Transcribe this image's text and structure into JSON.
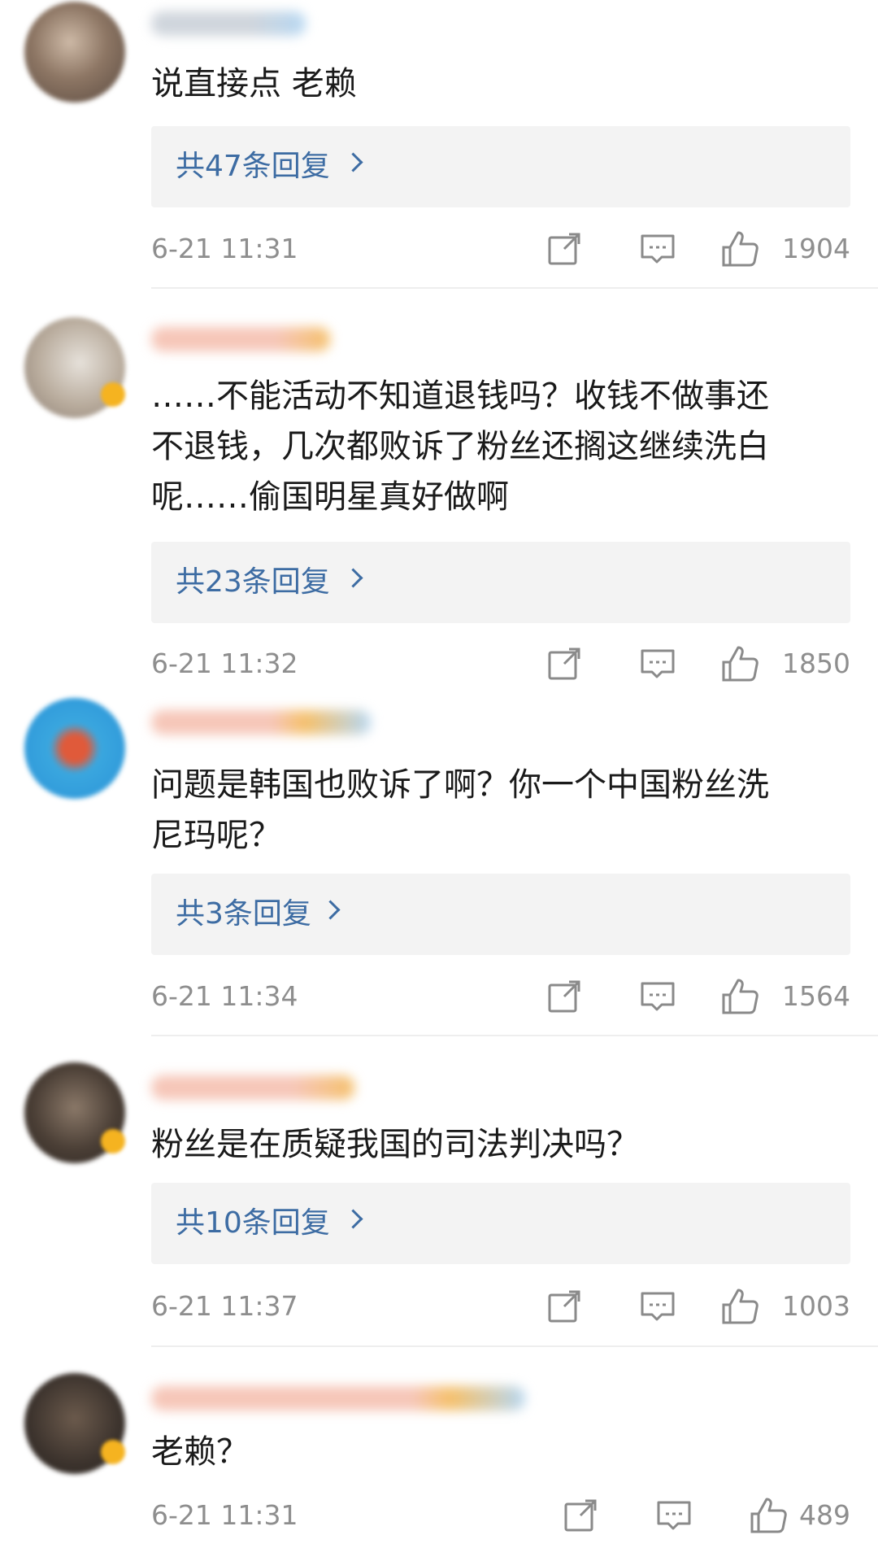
{
  "comments": [
    {
      "text": "说直接点 老赖",
      "replies_label": "共47条回复",
      "time": "6-21 11:31",
      "likes": "1904"
    },
    {
      "text": "……不能活动不知道退钱吗？收钱不做事还\n不退钱，几次都败诉了粉丝还搁这继续洗白\n呢……偷国明星真好做啊",
      "replies_label": "共23条回复",
      "time": "6-21 11:32",
      "likes": "1850"
    },
    {
      "text": "问题是韩国也败诉了啊？你一个中国粉丝洗\n尼玛呢？",
      "replies_label": "共3条回复",
      "time": "6-21 11:34",
      "likes": "1564"
    },
    {
      "text": "粉丝是在质疑我国的司法判决吗？",
      "replies_label": "共10条回复",
      "time": "6-21 11:37",
      "likes": "1003"
    },
    {
      "text": "老赖？",
      "time": "6-21 11:31",
      "likes": "489"
    }
  ],
  "icons": {
    "share": "share-icon",
    "reply": "comment-icon",
    "like": "thumbs-up-icon"
  },
  "colors": {
    "link": "#3d6ca3",
    "meta": "#8e8e8e",
    "reply_bg": "#f3f3f3"
  }
}
